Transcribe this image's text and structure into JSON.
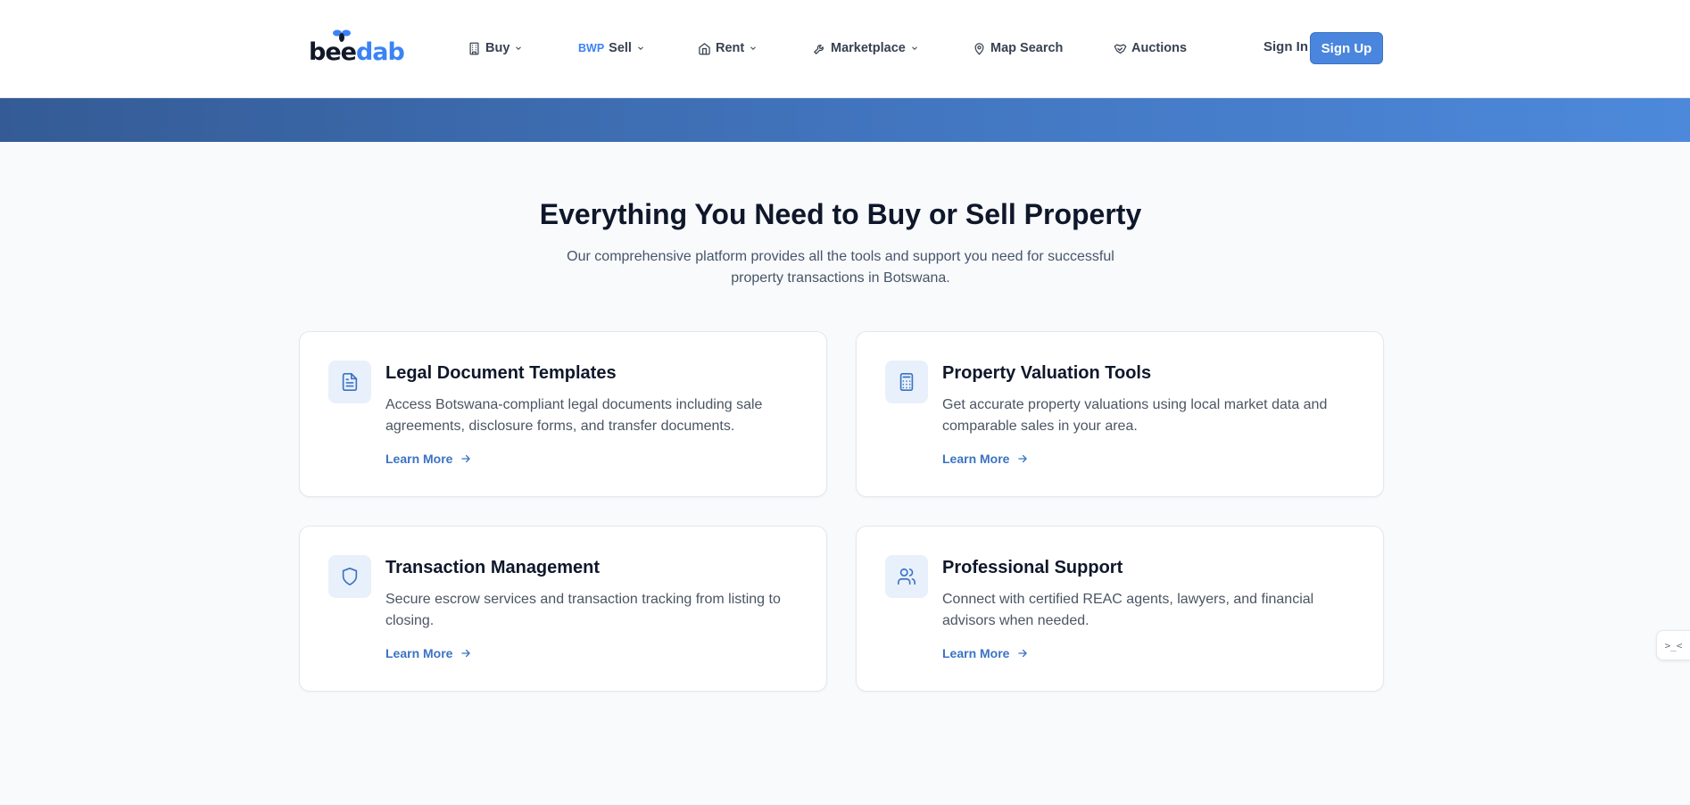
{
  "brand": {
    "part1": "bee",
    "part2": "dab"
  },
  "nav": {
    "items": [
      {
        "label": "Buy",
        "icon": "building-icon",
        "dropdown": true
      },
      {
        "prefix": "BWP",
        "label": "Sell",
        "dropdown": true
      },
      {
        "label": "Rent",
        "icon": "home-icon",
        "dropdown": true
      },
      {
        "label": "Marketplace",
        "icon": "wrench-icon",
        "dropdown": true
      },
      {
        "label": "Map Search",
        "icon": "map-pin-icon",
        "dropdown": false
      },
      {
        "label": "Auctions",
        "icon": "handshake-icon",
        "dropdown": false
      }
    ],
    "sign_in": "Sign In",
    "sign_up": "Sign Up"
  },
  "section": {
    "title": "Everything You Need to Buy or Sell Property",
    "subtitle": "Our comprehensive platform provides all the tools and support you need for successful property transactions in Botswana."
  },
  "cards": [
    {
      "title": "Legal Document Templates",
      "description": "Access Botswana-compliant legal documents including sale agreements, disclosure forms, and transfer documents.",
      "link": "Learn More",
      "icon": "file-text-icon"
    },
    {
      "title": "Property Valuation Tools",
      "description": "Get accurate property valuations using local market data and comparable sales in your area.",
      "link": "Learn More",
      "icon": "calculator-icon"
    },
    {
      "title": "Transaction Management",
      "description": "Secure escrow services and transaction tracking from listing to closing.",
      "link": "Learn More",
      "icon": "shield-icon"
    },
    {
      "title": "Professional Support",
      "description": "Connect with certified REAC agents, lawyers, and financial advisors when needed.",
      "link": "Learn More",
      "icon": "users-icon"
    }
  ],
  "widget": {
    "label": ">_<"
  },
  "colors": {
    "accent": "#4a86dd",
    "link": "#3b73c4",
    "title": "#0f172a",
    "body": "#4b5563"
  }
}
